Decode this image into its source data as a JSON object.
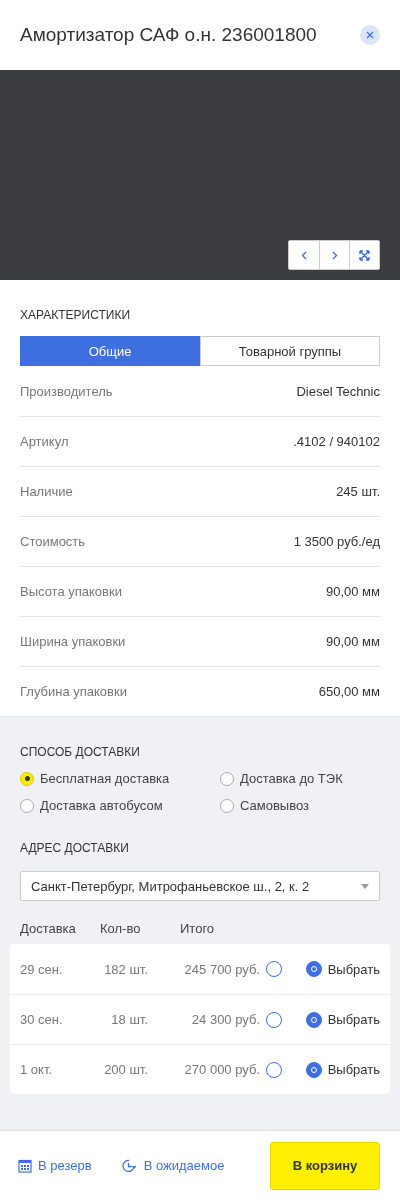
{
  "header": {
    "title": "Амортизатор САФ о.н. 236001800"
  },
  "gallery": {
    "nav": [
      {
        "kind": "prev"
      },
      {
        "kind": "next"
      },
      {
        "kind": "fullscreen"
      }
    ]
  },
  "specs": {
    "title": "ХАРАКТЕРИСТИКИ",
    "tabs": [
      {
        "label": "Общие",
        "selected": true
      },
      {
        "label": "Товарной группы",
        "selected": false
      }
    ],
    "rows": [
      {
        "label": "Производитель",
        "value": "Diesel Technic"
      },
      {
        "label": "Артикул",
        "value": ".4102 / 940102"
      },
      {
        "label": "Наличие",
        "value": "245 шт."
      },
      {
        "label": "Стоимость",
        "value": "1 3500 руб./ед"
      },
      {
        "label": "Высота упаковки",
        "value": "90,00 мм"
      },
      {
        "label": "Ширина упаковки",
        "value": "90,00 мм"
      },
      {
        "label": "Глубина упаковки",
        "value": "650,00 мм"
      }
    ]
  },
  "delivery": {
    "title": "СПОСОБ ДОСТАВКИ",
    "options": [
      {
        "label": "Бесплатная доставка",
        "selected": true
      },
      {
        "label": "Доставка до ТЭК",
        "selected": false
      },
      {
        "label": "Доставка автобусом",
        "selected": false
      },
      {
        "label": "Самовывоз",
        "selected": false
      }
    ],
    "address_title": "АДРЕС ДОСТАВКИ",
    "address": "Санкт-Петербург, Митрофаньевское ш., 2, к. 2",
    "columns": [
      "Доставка",
      "Кол-во",
      "Итого"
    ],
    "rows": [
      {
        "date": "29 сен.",
        "qty": "182 шт.",
        "total": "245 700 руб.",
        "radio_selected": false,
        "choose": "Выбрать",
        "choose_selected": true
      },
      {
        "date": "30 сен.",
        "qty": "18 шт.",
        "total": "24 300 руб.",
        "radio_selected": false,
        "choose": "Выбрать",
        "choose_selected": true
      },
      {
        "date": "1 окт.",
        "qty": "200 шт.",
        "total": "270 000 руб.",
        "radio_selected": false,
        "choose": "Выбрать",
        "choose_selected": true
      }
    ]
  },
  "footer": {
    "actions": [
      {
        "kind": "reserve",
        "label": "В резерв"
      },
      {
        "kind": "expected",
        "label": "В ожидаемое"
      }
    ],
    "primary": "В корзину"
  }
}
